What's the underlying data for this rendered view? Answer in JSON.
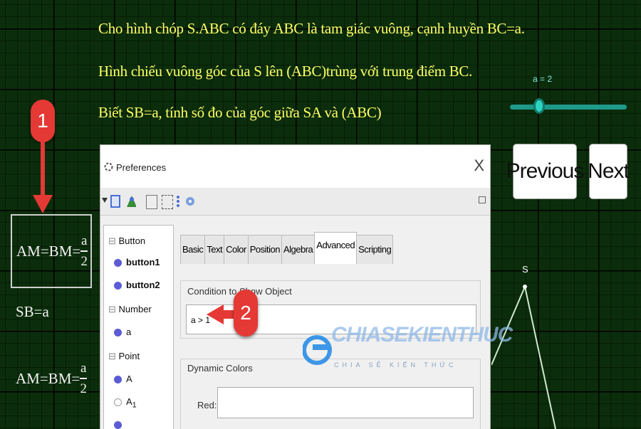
{
  "problem": {
    "line1": "Cho hình chóp S.ABC có đáy ABC là tam giác vuông, cạnh huyền BC=a.",
    "line2": "Hình chiếu vuông góc của S lên (ABC)trùng với trung điểm BC.",
    "line3": "Biết SB=a, tính số đo của góc giữa SA và (ABC)"
  },
  "slider": {
    "label": "a = 2",
    "value": 2
  },
  "nav": {
    "previous": "Previous",
    "next": "Next"
  },
  "left_math": {
    "boxed_lhs": "AM=BM=",
    "frac_num": "a",
    "frac_den": "2",
    "sb": "SB=a",
    "lhs2": "AM=BM="
  },
  "point_label": "S",
  "callouts": {
    "one": "1",
    "two": "2"
  },
  "preferences": {
    "title": "Preferences",
    "close": "X",
    "tree": [
      "Button",
      "button1",
      "button2",
      "Number",
      "a",
      "Point",
      "A",
      "A"
    ],
    "tree_sub": "1",
    "tabs": [
      "Basic",
      "Text",
      "Color",
      "Position",
      "Algebra",
      "Advanced",
      "Scripting"
    ],
    "condition_label": "Condition to Show Object",
    "condition_value": "a > 1",
    "dynamic_colors_label": "Dynamic Colors",
    "red_label": "Red:"
  },
  "watermark": {
    "brand": "CHIASEKIENTHUC",
    "tagline": "CHIA SẺ KIẾN THỨC"
  },
  "colors": {
    "problem_text": "#ffff66",
    "callout": "#e53935",
    "slider": "#2ed4c2"
  }
}
